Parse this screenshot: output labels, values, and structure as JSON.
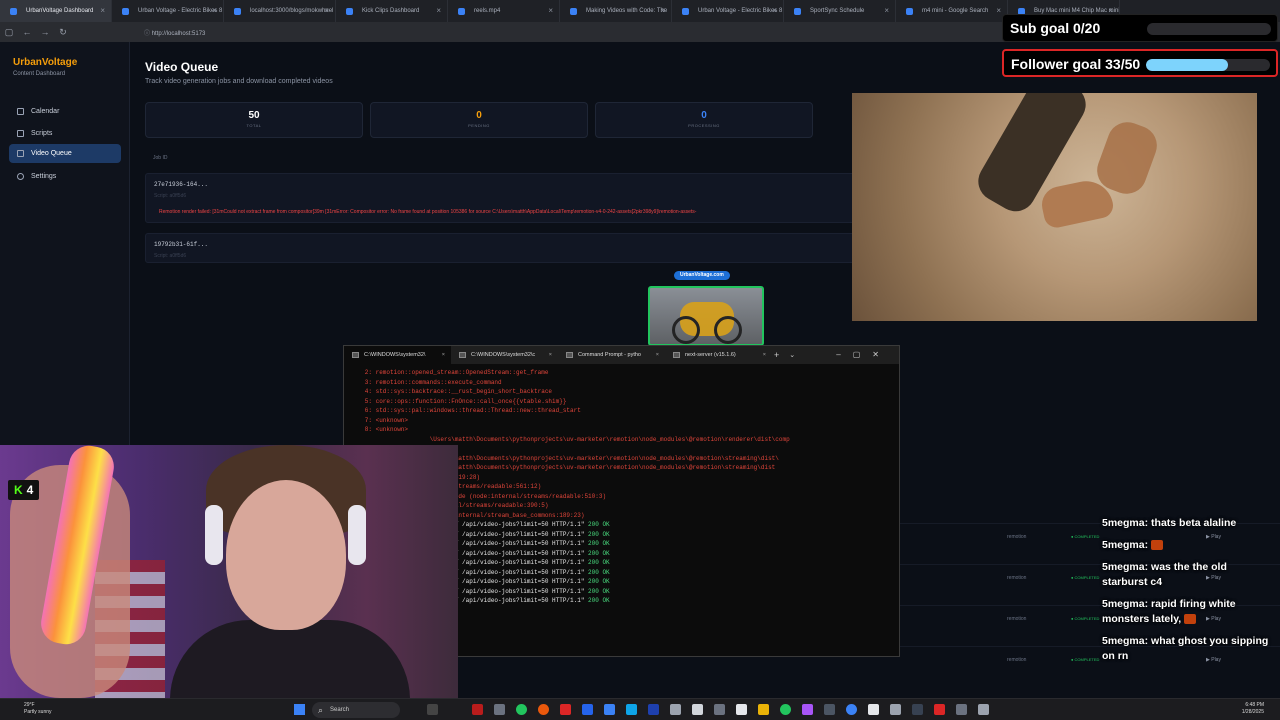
{
  "browser": {
    "tabs": [
      {
        "label": "UrbanVoltage Dashboard",
        "active": true
      },
      {
        "label": "Urban Voltage - Electric Bikes 8",
        "active": false
      },
      {
        "label": "localhost:3000/blogs/mokwheel",
        "active": false
      },
      {
        "label": "Kick Clips Dashboard",
        "active": false
      },
      {
        "label": "reels.mp4",
        "active": false
      },
      {
        "label": "Making Videos with Code: The",
        "active": false
      },
      {
        "label": "Urban Voltage - Electric Bikes 8",
        "active": false
      },
      {
        "label": "SportSync Schedule",
        "active": false
      },
      {
        "label": "m4 mini - Google Search",
        "active": false
      },
      {
        "label": "Buy Mac mini M4 Chip Mac mini",
        "active": false
      }
    ],
    "url": "http://localhost:5173"
  },
  "sidebar": {
    "brand": "UrbanVoltage",
    "subtitle": "Content Dashboard",
    "items": [
      {
        "label": "Calendar",
        "active": false
      },
      {
        "label": "Scripts",
        "active": false
      },
      {
        "label": "Video Queue",
        "active": true
      },
      {
        "label": "Settings",
        "active": false
      }
    ]
  },
  "main": {
    "title": "Video Queue",
    "subtitle": "Track video generation jobs and download completed videos",
    "stats": [
      {
        "value": "50",
        "label": "TOTAL"
      },
      {
        "value": "0",
        "label": "PENDING"
      },
      {
        "value": "0",
        "label": "PROCESSING"
      }
    ],
    "column_header": "Job ID",
    "jobs": [
      {
        "id": "27e71936-164...",
        "script": "Script: a0ff5d6",
        "error": "Remotion render failed: [31mCould not extract frame from compositor[39m [31mError: Compositor error: No frame found at position 105386 for source C:\\Users\\matth\\AppData\\Local\\Temp\\remotion-v4-0-242-assets[2pkr398y9]\\remotion-assets-"
      },
      {
        "id": "19792b31-61f...",
        "script": "Script: a0ff5d6",
        "error": ""
      }
    ],
    "right_rows": [
      {
        "source": "remotion",
        "status": "COMPLETED",
        "action": "▶ Play"
      },
      {
        "source": "remotion",
        "status": "COMPLETED",
        "action": "▶ Play"
      },
      {
        "source": "remotion",
        "status": "COMPLETED",
        "action": "▶ Play"
      },
      {
        "source": "remotion",
        "status": "COMPLETED",
        "action": "▶ Play"
      }
    ]
  },
  "thumbnail": {
    "pill": "UrbanVoltage.com"
  },
  "overlay": {
    "sub_goal": "Sub goal 0/20",
    "sub_progress": 0,
    "follower_goal": "Follower goal 33/50",
    "follower_progress": 0.66
  },
  "terminal": {
    "tabs": [
      {
        "label": "C:\\WINDOWS\\system32\\",
        "active": true
      },
      {
        "label": "C:\\WINDOWS\\system32\\c",
        "active": false
      },
      {
        "label": "Command Prompt - pytho",
        "active": false
      },
      {
        "label": "next-server (v15.1.6)",
        "active": false
      }
    ],
    "lines": [
      {
        "text": "   2: remotion::opened_stream::OpenedStream::get_frame",
        "color": "red"
      },
      {
        "text": "   3: remotion::commands::execute_command",
        "color": "red"
      },
      {
        "text": "   4: std::sys::backtrace::__rust_begin_short_backtrace",
        "color": "red"
      },
      {
        "text": "   5: core::ops::function::FnOnce::call_once{{vtable.shim}}",
        "color": "red"
      },
      {
        "text": "   6: std::sys::pal::windows::thread::Thread::new::thread_start",
        "color": "red"
      },
      {
        "text": "   7: <unknown>",
        "color": "red"
      },
      {
        "text": "   8: <unknown>",
        "color": "red"
      },
      {
        "text": "",
        "color": "red"
      },
      {
        "text": "                     \\Users\\matth\\Documents\\pythonprojects\\uv-marketer\\remotion\\node_modules\\@remotion\\renderer\\dist\\comp",
        "color": "red"
      },
      {
        "text": "                     s:7)",
        "color": "red"
      },
      {
        "text": "                     \\Users\\matth\\Documents\\pythonprojects\\uv-marketer\\remotion\\node_modules\\@remotion\\streaming\\dist\\",
        "color": "red"
      },
      {
        "text": "",
        "color": "red"
      },
      {
        "text": "                     \\Users\\matth\\Documents\\pythonprojects\\uv-marketer\\remotion\\node_modules\\@remotion\\streaming\\dist",
        "color": "red"
      },
      {
        "text": "",
        "color": "red"
      },
      {
        "text": "                     events:519:28)",
        "color": "red"
      },
      {
        "text": "                     ternal/streams/readable:561:12)",
        "color": "red"
      },
      {
        "text": "                     nkByteMode (node:internal/streams/readable:510:3)",
        "color": "red"
      },
      {
        "text": "                     :internal/streams/readable:390:5)",
        "color": "red"
      },
      {
        "text": "                      (node:internal/stream_base_commons:189:23)",
        "color": "red"
      },
      {
        "text": "",
        "color": "red"
      },
      {
        "text": "                     3 - \"GET /api/video-jobs?limit=50 HTTP/1.1\" 200 OK",
        "color": "white"
      },
      {
        "text": "                     3 - \"GET /api/video-jobs?limit=50 HTTP/1.1\" 200 OK",
        "color": "white"
      },
      {
        "text": "                     2 - \"GET /api/video-jobs?limit=50 HTTP/1.1\" 200 OK",
        "color": "white"
      },
      {
        "text": "                     3 - \"GET /api/video-jobs?limit=50 HTTP/1.1\" 200 OK",
        "color": "white"
      },
      {
        "text": "                     3 - \"GET /api/video-jobs?limit=50 HTTP/1.1\" 200 OK",
        "color": "white"
      },
      {
        "text": "                     2 - \"GET /api/video-jobs?limit=50 HTTP/1.1\" 200 OK",
        "color": "white"
      },
      {
        "text": "                     3 - \"GET /api/video-jobs?limit=50 HTTP/1.1\" 200 OK",
        "color": "white"
      },
      {
        "text": "                     3 - \"GET /api/video-jobs?limit=50 HTTP/1.1\" 200 OK",
        "color": "white"
      },
      {
        "text": "                     3 - \"GET /api/video-jobs?limit=50 HTTP/1.1\" 200 OK",
        "color": "white"
      }
    ]
  },
  "webcam": {
    "kick_count": "4"
  },
  "chat": [
    {
      "user": "5megma:",
      "text": "thats beta alaline",
      "emote": false
    },
    {
      "user": "5megma:",
      "text": "",
      "emote": true
    },
    {
      "user": "5megma:",
      "text": "was the the old starburst c4",
      "emote": false
    },
    {
      "user": "5megma:",
      "text": "rapid firing white monsters lately,",
      "emote": true
    },
    {
      "user": "5megma:",
      "text": "what ghost you sipping on rn",
      "emote": false
    }
  ],
  "taskbar": {
    "weather": "29°F",
    "weather_sub": "Partly sunny",
    "search_label": "Search",
    "time": "6:48 PM",
    "date": "1/28/2025"
  },
  "colors": {
    "accent": "#f59e0b",
    "active_nav": "#1d3a66",
    "error": "#ef4444",
    "success": "#22c55e"
  }
}
